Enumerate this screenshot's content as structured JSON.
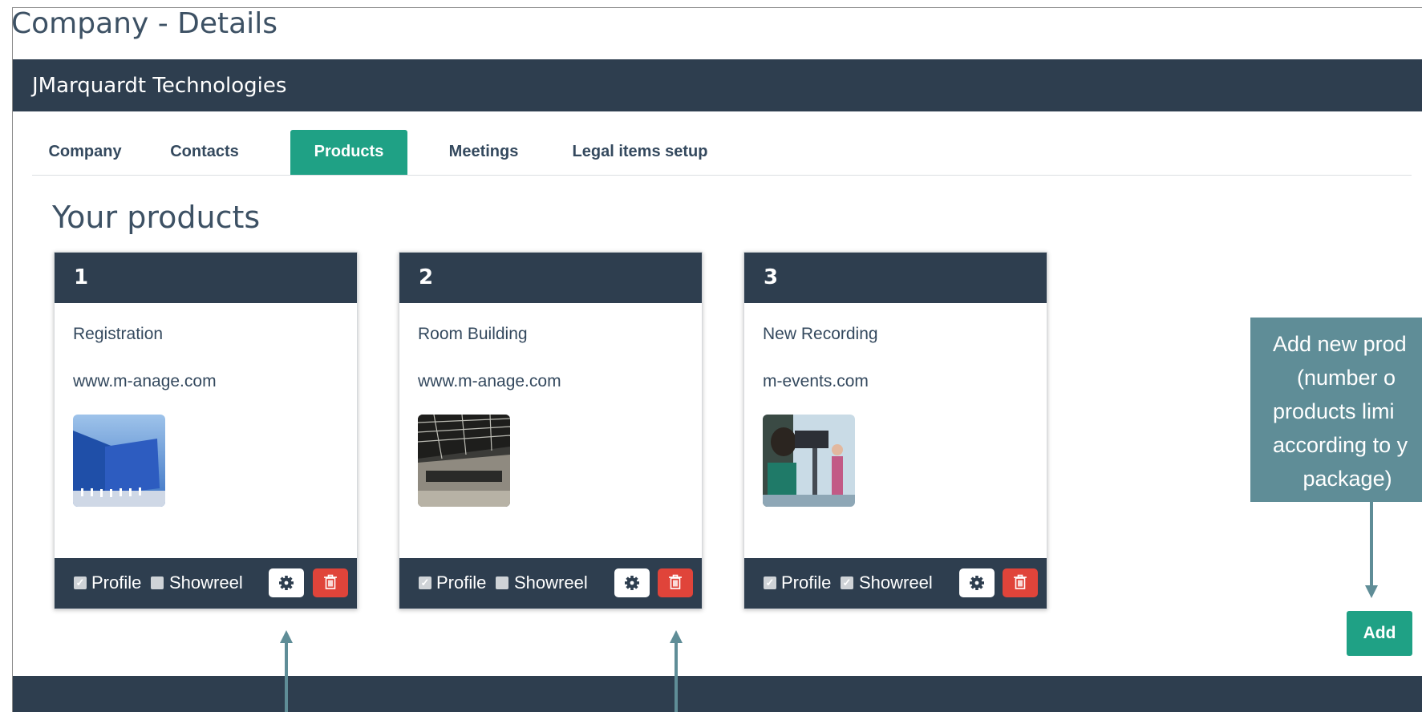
{
  "page": {
    "title": "Company - Details"
  },
  "company": {
    "name": "JMarquardt Technologies"
  },
  "tabs": [
    {
      "label": "Company",
      "active": false
    },
    {
      "label": "Contacts",
      "active": false
    },
    {
      "label": "Products",
      "active": true
    },
    {
      "label": "Meetings",
      "active": false
    },
    {
      "label": "Legal items setup",
      "active": false
    }
  ],
  "section": {
    "title": "Your products"
  },
  "products": [
    {
      "number": "1",
      "name": "Registration",
      "url": "www.m-anage.com",
      "profile_label": "Profile",
      "profile_checked": true,
      "showreel_label": "Showreel",
      "showreel_checked": false
    },
    {
      "number": "2",
      "name": "Room Building",
      "url": "www.m-anage.com",
      "profile_label": "Profile",
      "profile_checked": true,
      "showreel_label": "Showreel",
      "showreel_checked": false
    },
    {
      "number": "3",
      "name": "New Recording",
      "url": "m-events.com",
      "profile_label": "Profile",
      "profile_checked": true,
      "showreel_label": "Showreel",
      "showreel_checked": true
    }
  ],
  "callout": {
    "text": "Add new prod\n    (number o\nproducts limi\naccording to y\n     package)"
  },
  "add_button": {
    "label": "Add"
  },
  "icons": {
    "settings": "gear-icon",
    "delete": "trash-icon",
    "check": "checkmark-icon"
  },
  "colors": {
    "header": "#2e3e4f",
    "accent": "#1fa185",
    "danger": "#e0443a",
    "callout": "#5f8d97"
  }
}
